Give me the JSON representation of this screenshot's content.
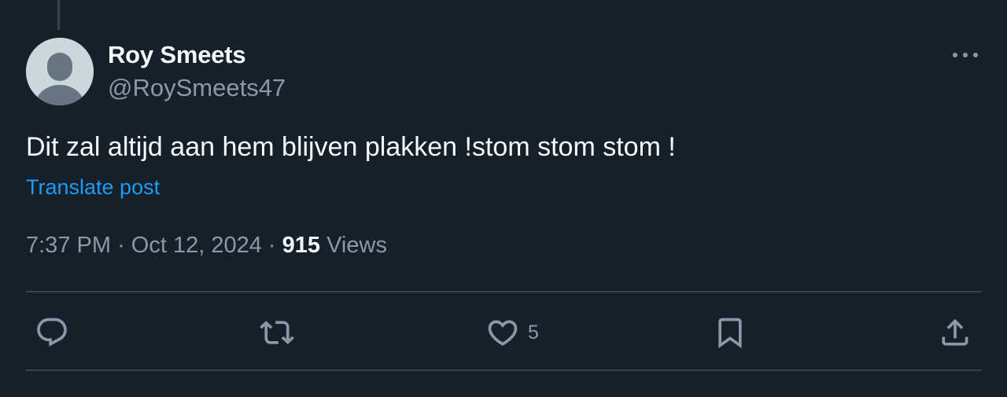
{
  "post": {
    "author_name": "Roy Smeets",
    "author_handle": "@RoySmeets47",
    "text": "Dit zal altijd aan hem blijven plakken !stom stom stom !",
    "translate_label": "Translate post",
    "time": "7:37 PM",
    "date": "Oct 12, 2024",
    "separator": "·",
    "views_count": "915",
    "views_label": "Views"
  },
  "actions": {
    "reply_icon": "reply-icon",
    "repost_icon": "repost-icon",
    "like_icon": "heart-icon",
    "like_count": "5",
    "bookmark_icon": "bookmark-icon",
    "share_icon": "share-icon"
  },
  "colors": {
    "background": "#15202b",
    "text_primary": "#f7f9f9",
    "text_secondary": "#8b98a5",
    "link": "#1d9bf0",
    "divider": "#38444d"
  }
}
